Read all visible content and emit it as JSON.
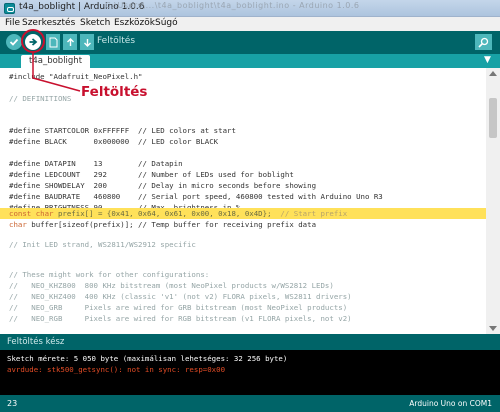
{
  "window": {
    "title": "t4a_boblight | Arduino 1.0.6",
    "blurred_path": "C:\\Users\\...\\t4a_boblight\\t4a_boblight.ino - Arduino 1.0.6"
  },
  "menu": {
    "items": [
      "File",
      "Szerkesztés",
      "Sketch",
      "Eszközök",
      "Súgó"
    ]
  },
  "toolbar": {
    "hover_label": "Feltöltés",
    "buttons": [
      "verify-icon",
      "upload-icon",
      "new-icon",
      "open-icon",
      "save-icon",
      "serial-monitor-icon"
    ]
  },
  "annotation": {
    "label": "Feltöltés",
    "color": "#c8102e"
  },
  "tabs": {
    "active": "t4a_boblight",
    "menu_glyph": "▼"
  },
  "code": {
    "l01": "#include \"Adafruit_NeoPixel.h\"",
    "l02": "",
    "l03": "// DEFINITIONS",
    "l04": "",
    "l05": "",
    "l06": "#define STARTCOLOR 0xFFFFFF  // LED colors at start",
    "l07": "#define BLACK      0x000000  // LED color BLACK",
    "l08": "",
    "l09": "#define DATAPIN    13        // Datapin",
    "l10": "#define LEDCOUNT   292       // Number of LEDs used for boblight",
    "l11": "#define SHOWDELAY  200       // Delay in micro seconds before showing",
    "l12": "#define BAUDRATE   460800    // Serial port speed, 460800 tested with Arduino Uno R3",
    "l13": "#define BRIGHTNESS 90        // Max. brightness in %",
    "l14": "",
    "l15_kw": "const char",
    "l15_body": " prefix[] = {0x41, 0x64, 0x61, 0x00, 0x18, 0x4D};",
    "l15_cm": "  // Start prefix",
    "l16_kw": "char",
    "l16_body": " buffer[sizeof(prefix)]; // Temp buffer for receiving prefix data",
    "l17": "",
    "l18": "// Init LED strand, WS2811/WS2912 specific",
    "l19": "",
    "l20": "",
    "l21": "// These might work for other configurations:",
    "l22": "//   NEO_KHZ800  800 KHz bitstream (most NeoPixel products w/WS2812 LEDs)",
    "l23": "//   NEO_KHZ400  400 KHz (classic 'v1' (not v2) FLORA pixels, WS2811 drivers)",
    "l24": "//   NEO_GRB     Pixels are wired for GRB bitstream (most NeoPixel products)",
    "l25": "//   NEO_RGB     Pixels are wired for RGB bitstream (v1 FLORA pixels, not v2)"
  },
  "status": {
    "text": "Feltöltés kész"
  },
  "console": {
    "line1": "Sketch mérete: 5 050 byte (maximálisan lehetséges: 32 256 byte)",
    "line2": "avrdude: stk500_getsync(): not in sync: resp=0x00"
  },
  "footer": {
    "line": "23",
    "board": "Arduino Uno on COM1"
  },
  "colors": {
    "toolbar": "#006468",
    "tabs": "#17a1a5",
    "highlight": "#ffe15a",
    "error": "#e34c26"
  }
}
